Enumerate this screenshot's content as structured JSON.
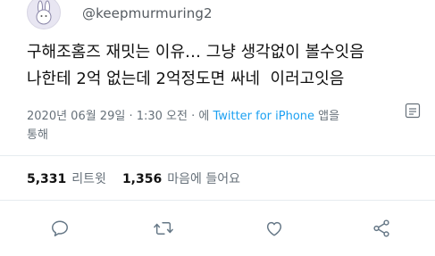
{
  "user": {
    "handle": "@keepmurmuring2"
  },
  "tweet": {
    "line1": "구해조홈즈 재밋는 이유… 그냥 생각없이 볼수잇음",
    "line2": "나한테 2억 없는데 2억정도면 싸네  이러고잇음"
  },
  "meta": {
    "date": "2020년 06월 29일 · 1:30 오전 · 에 ",
    "source": "Twitter for iPhone",
    "via_suffix": " 앱을",
    "via_line2": "통해"
  },
  "stats": {
    "retweets_count": "5,331",
    "retweets_label": "리트윗",
    "likes_count": "1,356",
    "likes_label": "마음에 들어요"
  },
  "colors": {
    "link": "#1da1f2",
    "muted": "#67717a",
    "icon": "#657786",
    "divider": "#e6ecf0"
  },
  "icons": {
    "reply": "reply-icon",
    "retweet": "retweet-icon",
    "like": "heart-icon",
    "share": "share-icon",
    "caret": "menu-caret-icon"
  }
}
